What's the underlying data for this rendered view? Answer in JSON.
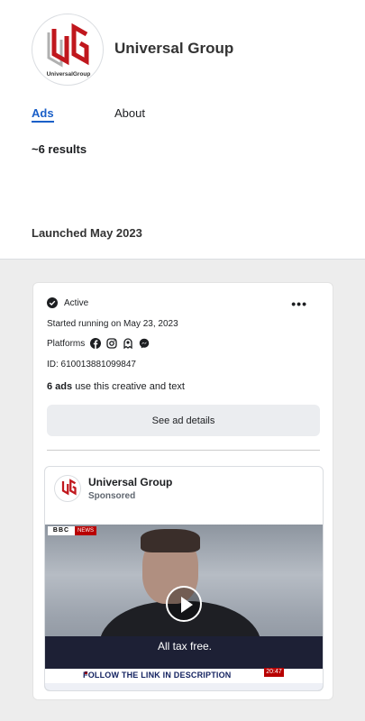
{
  "header": {
    "page_name": "Universal Group",
    "logo_text": "UniversalGroup"
  },
  "tabs": [
    {
      "label": "Ads",
      "active": true
    },
    {
      "label": "About",
      "active": false
    }
  ],
  "results_count": "~6 results",
  "launched_label": "Launched May 2023",
  "ad_card": {
    "status": "Active",
    "more_label": "•••",
    "started": "Started running on May 23, 2023",
    "platforms_label": "Platforms",
    "platform_icons": [
      "facebook-icon",
      "instagram-icon",
      "audience-network-icon",
      "messenger-icon"
    ],
    "ad_id": "ID: 610013881099847",
    "ads_count": "6 ads",
    "ads_suffix": " use this creative and text",
    "details_button": "See ad details",
    "preview": {
      "advertiser": "Universal Group",
      "sponsored": "Sponsored",
      "video": {
        "network_badge": "BBC",
        "network_label": "NEWS",
        "caption": "All tax free.",
        "ticker": "FOLLOW THE LINK IN DESCRIPTION",
        "time": "20:47"
      }
    }
  },
  "colors": {
    "accent": "#1a5fc8",
    "logo_red": "#c0171d",
    "background": "#ededed"
  }
}
